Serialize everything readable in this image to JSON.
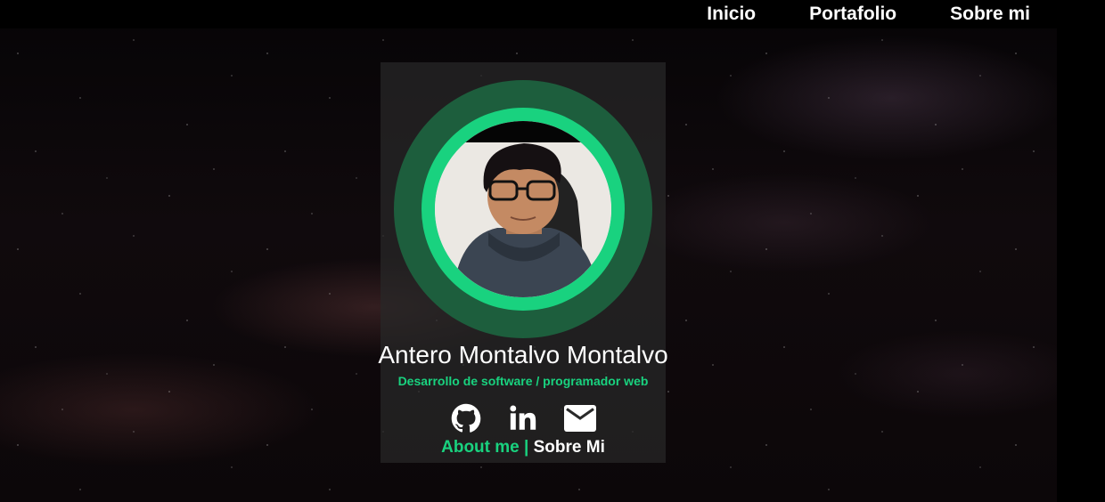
{
  "nav": {
    "items": [
      "Inicio",
      "Portafolio",
      "Sobre mi"
    ]
  },
  "profile": {
    "name": "Antero Montalvo Montalvo",
    "subtitle": "Desarrollo de software / programador web"
  },
  "socials": {
    "icons": [
      "github-icon",
      "linkedin-icon",
      "mail-icon"
    ]
  },
  "links": {
    "about": "About me",
    "separator": "|",
    "sobre": "Sobre Mi"
  },
  "colors": {
    "accent": "#19d27f",
    "ring_dark": "#1d5e3d",
    "card": "#282828"
  }
}
